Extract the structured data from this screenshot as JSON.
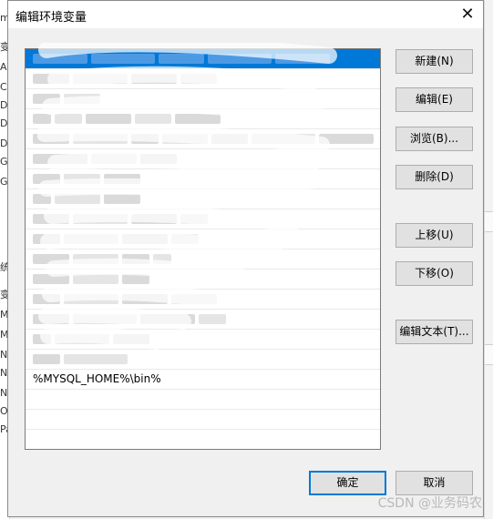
{
  "dialog": {
    "title": "编辑环境变量",
    "close_glyph": "✕"
  },
  "path_list": {
    "items": [
      {
        "text": "C:\\Program Files (x86)\\Common Files\\...",
        "selected": true
      },
      {
        "text": "%SystemRoot%\\system32"
      },
      {
        "text": "%SystemRoot%"
      },
      {
        "text": "%SystemRoot%\\System32\\Wbem"
      },
      {
        "text": "%SYSTEMROOT%\\System32\\WindowsPowerShell\\v1.0\\"
      },
      {
        "text": "%SYSTEMROOT%\\System32\\OpenSSH\\"
      },
      {
        "text": "E:\\...\\Git\\cmd"
      },
      {
        "text": "E:\\...\\nodejs\\"
      },
      {
        "text": "%JAVA_HOME%\\bin"
      },
      {
        "text": "%JAVA_HOME%\\jre\\bin"
      },
      {
        "text": "E:\\...\\...\\b"
      },
      {
        "text": "%...%\\b..."
      },
      {
        "text": "C:\\...\\...dll"
      },
      {
        "text": "C:\\...\\...\\bin"
      },
      {
        "text": "%...HOME%"
      },
      {
        "text": "%...%"
      },
      {
        "text": "%MYSQL_HOME%\\bin%",
        "visible": true
      },
      {
        "text": ""
      },
      {
        "text": ""
      },
      {
        "text": ""
      },
      {
        "text": ""
      }
    ],
    "visible_item": "%MYSQL_HOME%\\bin%"
  },
  "buttons": {
    "new": "新建(N)",
    "edit": "编辑(E)",
    "browse": "浏览(B)...",
    "delete": "删除(D)",
    "move_up": "上移(U)",
    "move_down": "下移(O)",
    "edit_text": "编辑文本(T)...",
    "ok": "确定",
    "cancel": "取消"
  },
  "watermark": "CSDN @业务码农",
  "colors": {
    "selection": "#0078d7",
    "dialog_bg": "#f0f0f0",
    "button_bg": "#e1e1e1"
  }
}
